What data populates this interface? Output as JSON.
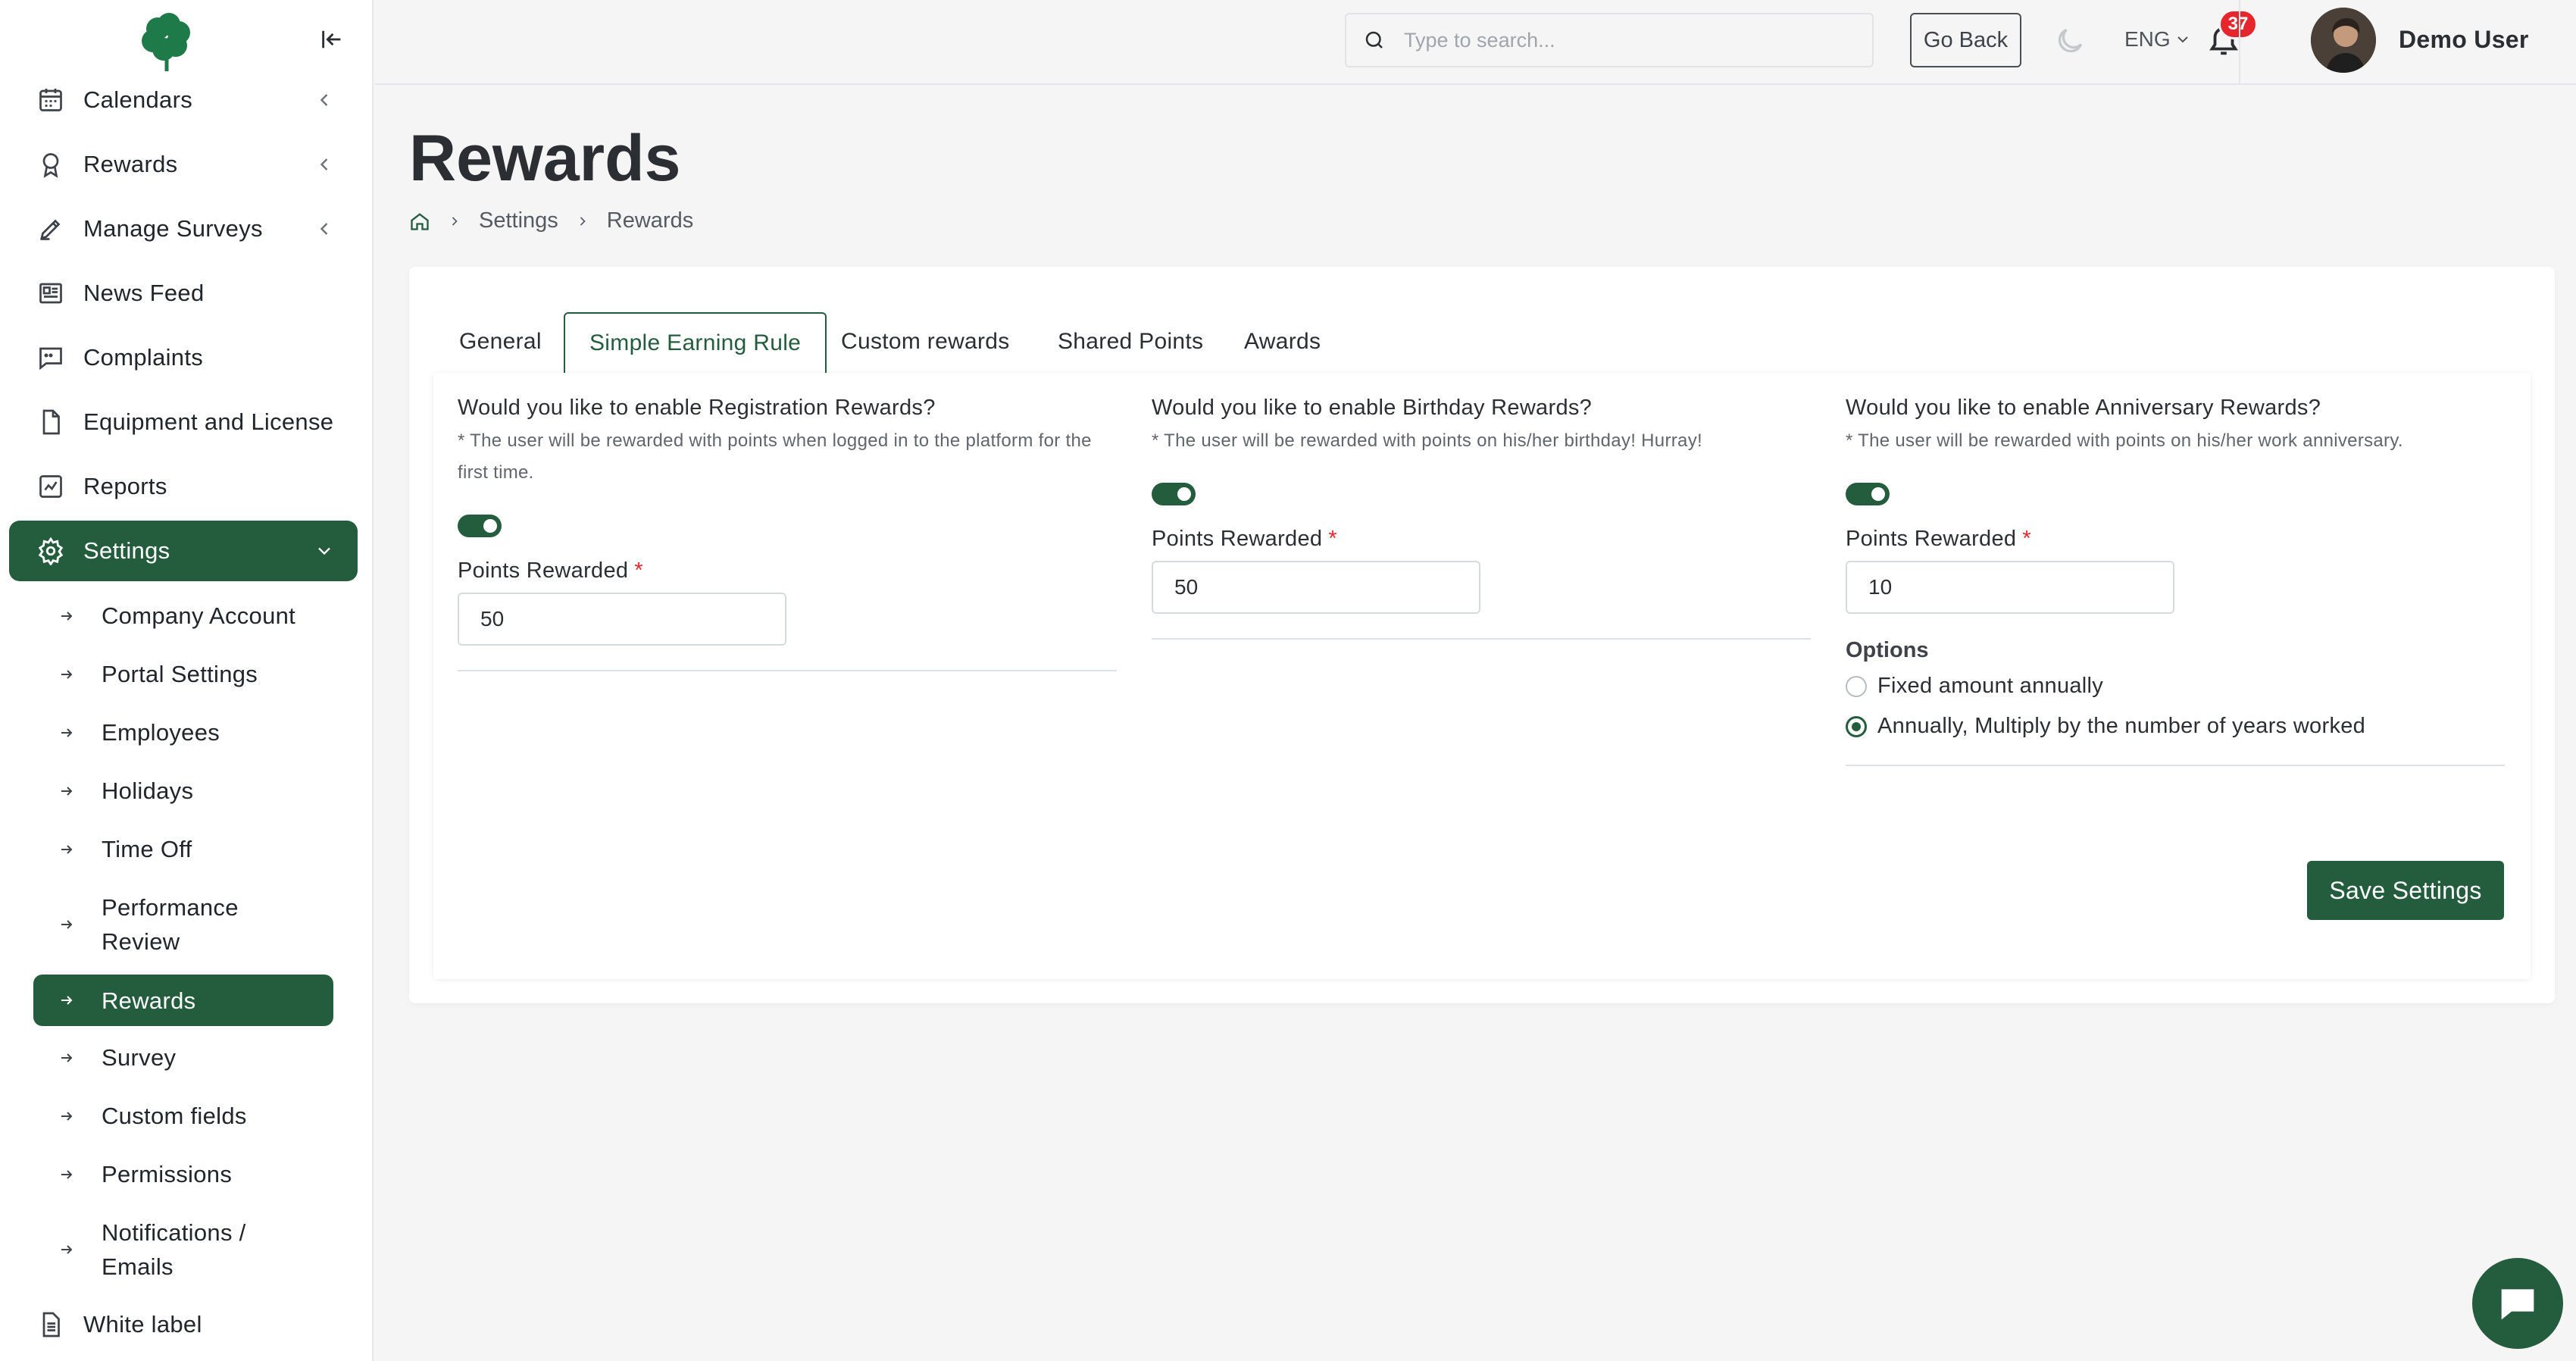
{
  "sidebar": {
    "items": [
      {
        "label": "Calendars"
      },
      {
        "label": "Rewards"
      },
      {
        "label": "Manage Surveys"
      },
      {
        "label": "News Feed"
      },
      {
        "label": "Complaints"
      },
      {
        "label": "Equipment and License"
      },
      {
        "label": "Reports"
      },
      {
        "label": "Settings"
      }
    ],
    "settings_sub": [
      {
        "label": "Company Account"
      },
      {
        "label": "Portal Settings"
      },
      {
        "label": "Employees"
      },
      {
        "label": "Holidays"
      },
      {
        "label": "Time Off"
      },
      {
        "label": "Performance Review"
      },
      {
        "label": "Rewards"
      },
      {
        "label": "Survey"
      },
      {
        "label": "Custom fields"
      },
      {
        "label": "Permissions"
      },
      {
        "label": "Notifications / Emails"
      }
    ],
    "bottom_item": {
      "label": "White label"
    }
  },
  "topbar": {
    "search_placeholder": "Type to search...",
    "go_back": "Go Back",
    "language": "ENG",
    "notification_count": "37",
    "user_name": "Demo User"
  },
  "page": {
    "title": "Rewards",
    "breadcrumb": [
      "Settings",
      "Rewards"
    ]
  },
  "tabs": [
    {
      "label": "General"
    },
    {
      "label": "Simple Earning Rule"
    },
    {
      "label": "Custom rewards"
    },
    {
      "label": "Shared Points"
    },
    {
      "label": "Awards"
    }
  ],
  "active_tab": "Simple Earning Rule",
  "registration": {
    "question": "Would you like to enable Registration Rewards?",
    "note": "* The user will be rewarded with points when logged in to the platform for the first time.",
    "enabled": true,
    "points_label": "Points Rewarded",
    "points_value": "50"
  },
  "birthday": {
    "question": "Would you like to enable Birthday Rewards?",
    "note": "* The user will be rewarded with points on his/her birthday! Hurray!",
    "enabled": true,
    "points_label": "Points Rewarded",
    "points_value": "50"
  },
  "anniversary": {
    "question": "Would you like to enable Anniversary Rewards?",
    "note": "* The user will be rewarded with points on his/her work anniversary.",
    "enabled": true,
    "points_label": "Points Rewarded",
    "points_value": "10",
    "options_label": "Options",
    "options": [
      {
        "label": "Fixed amount annually",
        "selected": false
      },
      {
        "label": "Annually, Multiply by the number of years worked",
        "selected": true
      }
    ]
  },
  "required_mark": "*",
  "save_button": "Save Settings",
  "colors": {
    "primary": "#235d3e",
    "danger": "#e5262d",
    "background": "#f5f5f6"
  }
}
